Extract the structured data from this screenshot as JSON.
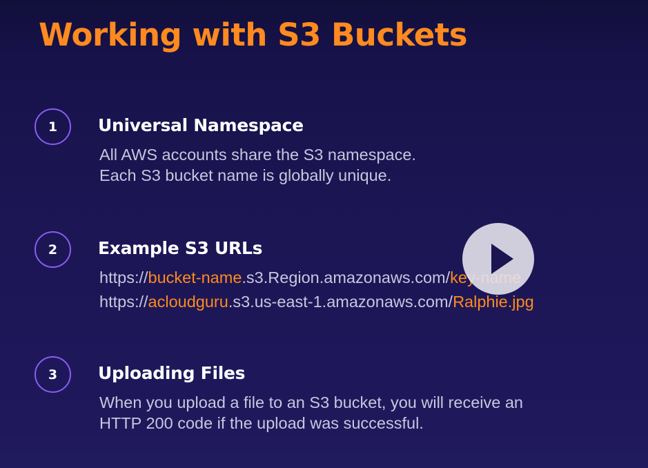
{
  "slide": {
    "title": "Working with S3 Buckets"
  },
  "items": [
    {
      "number": "1",
      "heading": "Universal Namespace",
      "lines": [
        "All AWS accounts share the S3 namespace.",
        "Each S3 bucket name is globally unique."
      ]
    },
    {
      "number": "2",
      "heading": "Example S3 URLs",
      "urls": [
        {
          "prefix": "https://",
          "bucket": "bucket-name",
          "middle": ".s3.Region.amazonaws.com/",
          "key": "key-name"
        },
        {
          "prefix": "https://",
          "bucket": "acloudguru",
          "middle": ".s3.us-east-1.amazonaws.com/",
          "key": "Ralphie.jpg"
        }
      ]
    },
    {
      "number": "3",
      "heading": "Uploading Files",
      "lines": [
        "When you upload a file to an S3 bucket, you will receive an",
        "HTTP 200 code if the upload was successful."
      ]
    }
  ],
  "player": {
    "icon": "play-icon"
  },
  "colors": {
    "accent_orange": "#ff8a1f",
    "circle_purple": "#8b5cf6",
    "background": "#1b1552",
    "body_text": "#c9c6de"
  }
}
